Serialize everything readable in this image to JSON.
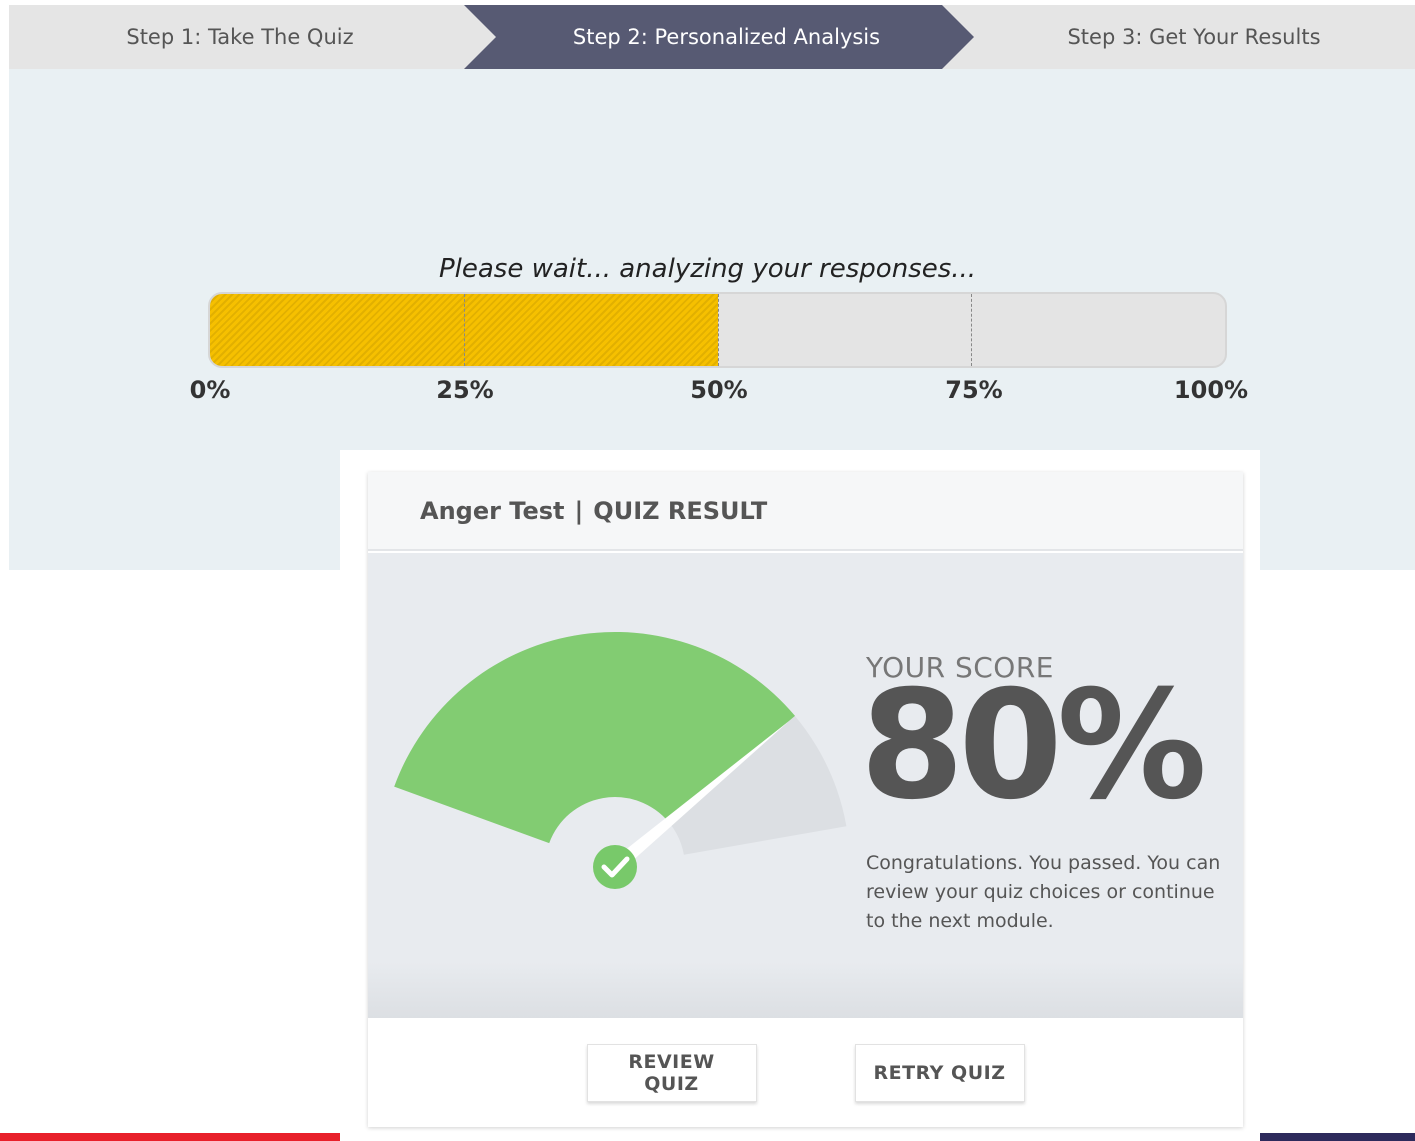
{
  "steps": [
    {
      "label": "Step 1: Take The Quiz",
      "active": false
    },
    {
      "label": "Step 2: Personalized Analysis",
      "active": true
    },
    {
      "label": "Step 3: Get Your Results",
      "active": false
    }
  ],
  "analysis": {
    "message": "Please wait... analyzing your responses...",
    "progress_percent": 50,
    "tick_labels": [
      "0%",
      "25%",
      "50%",
      "75%",
      "100%"
    ]
  },
  "quiz_result": {
    "title": "Anger Test",
    "separator": "|",
    "subtitle": "QUIZ RESULT",
    "score_label": "YOUR SCORE",
    "score_value": "80%",
    "score_fraction": 0.8,
    "message": "Congratulations. You passed. You can review your quiz choices or continue to the next module.",
    "buttons": {
      "review": "REVIEW QUIZ",
      "retry": "RETRY QUIZ"
    }
  },
  "icons": {
    "gauge_check": "check-circle-icon"
  },
  "colors": {
    "step_active_bg": "#575a73",
    "step_bg": "#e5e5e5",
    "panel_bg": "#e9f0f3",
    "progress_fill": "#f6c000",
    "gauge_green": "#82cc72",
    "gauge_grey": "#dcdfe3",
    "accent_left": "#e8202a",
    "accent_right": "#2d2a5c"
  }
}
